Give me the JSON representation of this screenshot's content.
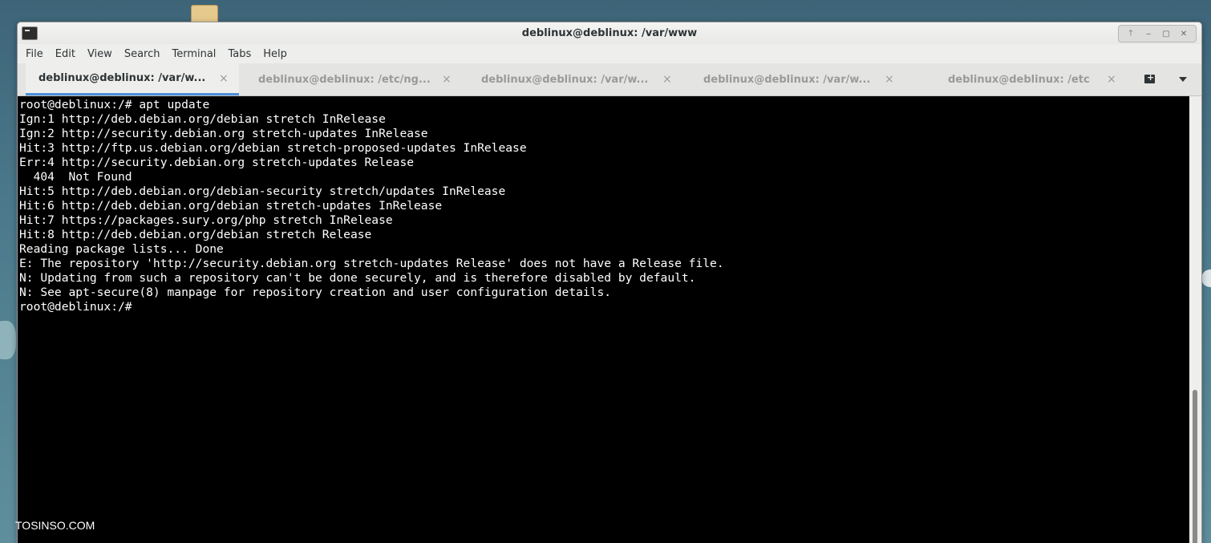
{
  "window": {
    "title": "deblinux@deblinux: /var/www",
    "buttons": [
      "🡑",
      "‒",
      "▢",
      "✕"
    ]
  },
  "menu": [
    "File",
    "Edit",
    "View",
    "Search",
    "Terminal",
    "Tabs",
    "Help"
  ],
  "tabs": [
    {
      "label": "deblinux@deblinux: /var/w...",
      "active": true
    },
    {
      "label": "deblinux@deblinux: /etc/ng...",
      "active": false
    },
    {
      "label": "deblinux@deblinux: /var/w...",
      "active": false
    },
    {
      "label": "deblinux@deblinux: /var/w...",
      "active": false
    },
    {
      "label": "deblinux@deblinux: /etc",
      "active": false
    }
  ],
  "tab_close_glyph": "×",
  "terminal_lines": [
    "root@deblinux:/# apt update",
    "Ign:1 http://deb.debian.org/debian stretch InRelease",
    "Ign:2 http://security.debian.org stretch-updates InRelease",
    "Hit:3 http://ftp.us.debian.org/debian stretch-proposed-updates InRelease",
    "Err:4 http://security.debian.org stretch-updates Release",
    "  404  Not Found",
    "Hit:5 http://deb.debian.org/debian-security stretch/updates InRelease",
    "Hit:6 http://deb.debian.org/debian stretch-updates InRelease",
    "Hit:7 https://packages.sury.org/php stretch InRelease",
    "Hit:8 http://deb.debian.org/debian stretch Release",
    "Reading package lists... Done",
    "E: The repository 'http://security.debian.org stretch-updates Release' does not have a Release file.",
    "N: Updating from such a repository can't be done securely, and is therefore disabled by default.",
    "N: See apt-secure(8) manpage for repository creation and user configuration details.",
    "root@deblinux:/# "
  ],
  "watermark": "TOSINSO.COM",
  "colors": {
    "terminal_bg": "#000000",
    "terminal_fg": "#ffffff",
    "active_tab_accent": "#4a90d9"
  }
}
